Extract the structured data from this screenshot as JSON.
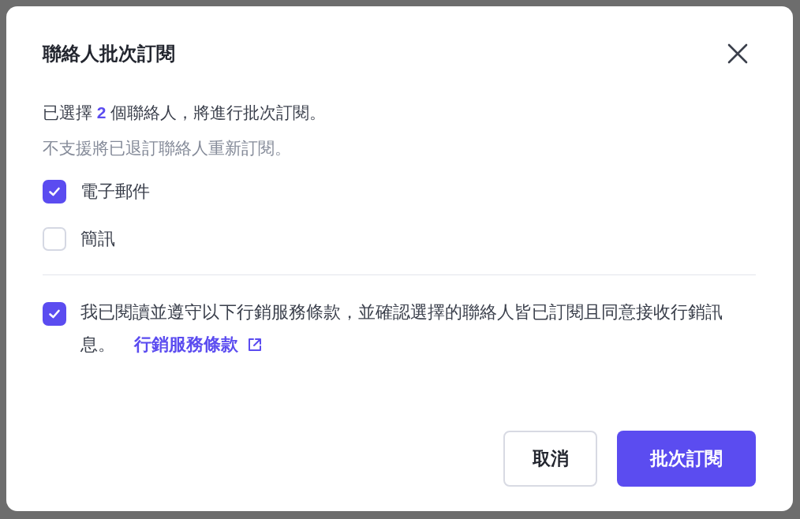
{
  "dialog": {
    "title": "聯絡人批次訂閱",
    "summary": "已選擇 **2** 個聯絡人，將進行批次訂閱。",
    "note": "不支援將已退訂聯絡人重新訂閱。",
    "channels": [
      {
        "label": "電子郵件",
        "checked": true
      },
      {
        "label": "簡訊",
        "checked": false
      }
    ],
    "agreement": {
      "checked": true,
      "text": "我已閱讀並遵守以下行銷服務條款，並確認選擇的聯絡人皆已訂閱且同意接收行銷訊息。",
      "link": "行銷服務條款"
    },
    "buttons": [
      {
        "label": "取消",
        "kind": "secondary"
      },
      {
        "label": "批次訂閱",
        "kind": "primary"
      }
    ]
  }
}
